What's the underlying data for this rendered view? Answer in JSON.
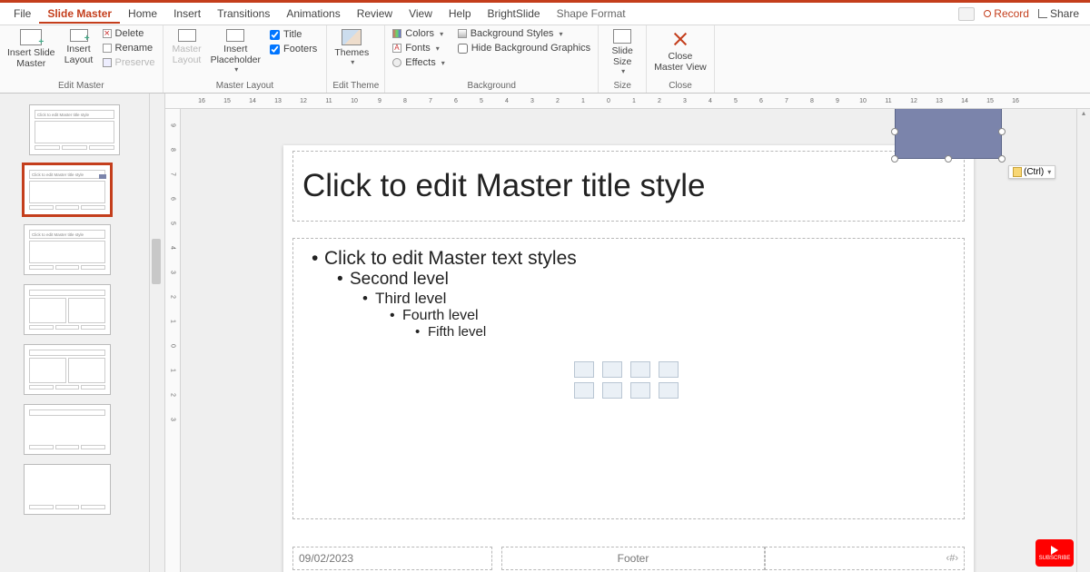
{
  "tabs": {
    "file": "File",
    "slide_master": "Slide Master",
    "home": "Home",
    "insert": "Insert",
    "transitions": "Transitions",
    "animations": "Animations",
    "review": "Review",
    "view": "View",
    "help": "Help",
    "brightslide": "BrightSlide",
    "shape_format": "Shape Format"
  },
  "titlebar_actions": {
    "record": "Record",
    "share": "Share"
  },
  "ribbon": {
    "edit_master": {
      "insert_slide_master": "Insert Slide\nMaster",
      "insert_layout": "Insert\nLayout",
      "delete": "Delete",
      "rename": "Rename",
      "preserve": "Preserve",
      "label": "Edit Master"
    },
    "master_layout": {
      "master_layout": "Master\nLayout",
      "insert_placeholder": "Insert\nPlaceholder",
      "title_chk": "Title",
      "footers_chk": "Footers",
      "label": "Master Layout"
    },
    "edit_theme": {
      "themes": "Themes",
      "label": "Edit Theme"
    },
    "background": {
      "colors": "Colors",
      "fonts": "Fonts",
      "effects": "Effects",
      "bg_styles": "Background Styles",
      "hide_bg": "Hide Background Graphics",
      "label": "Background"
    },
    "size": {
      "slide_size": "Slide\nSize",
      "label": "Size"
    },
    "close": {
      "close_master": "Close\nMaster View",
      "label": "Close"
    }
  },
  "ruler_h": [
    "16",
    "15",
    "14",
    "13",
    "12",
    "11",
    "10",
    "9",
    "8",
    "7",
    "6",
    "5",
    "4",
    "3",
    "2",
    "1",
    "0",
    "1",
    "2",
    "3",
    "4",
    "5",
    "6",
    "7",
    "8",
    "9",
    "10",
    "11",
    "12",
    "13",
    "14",
    "15",
    "16"
  ],
  "ruler_v": [
    "9",
    "8",
    "7",
    "6",
    "5",
    "4",
    "3",
    "2",
    "1",
    "0",
    "1",
    "2",
    "3"
  ],
  "slide": {
    "title_placeholder": "Click to edit Master title style",
    "body_levels": {
      "l1": "Click to edit Master text styles",
      "l2": "Second level",
      "l3": "Third level",
      "l4": "Fourth level",
      "l5": "Fifth level"
    },
    "date": "09/02/2023",
    "footer": "Footer",
    "slide_num": "‹#›"
  },
  "thumb_text": {
    "master_title": "Click to edit Master title style",
    "layout_title": "Click to edit Master title style"
  },
  "paste_tag": "(Ctrl)",
  "yt": "SUBSCRIBE"
}
